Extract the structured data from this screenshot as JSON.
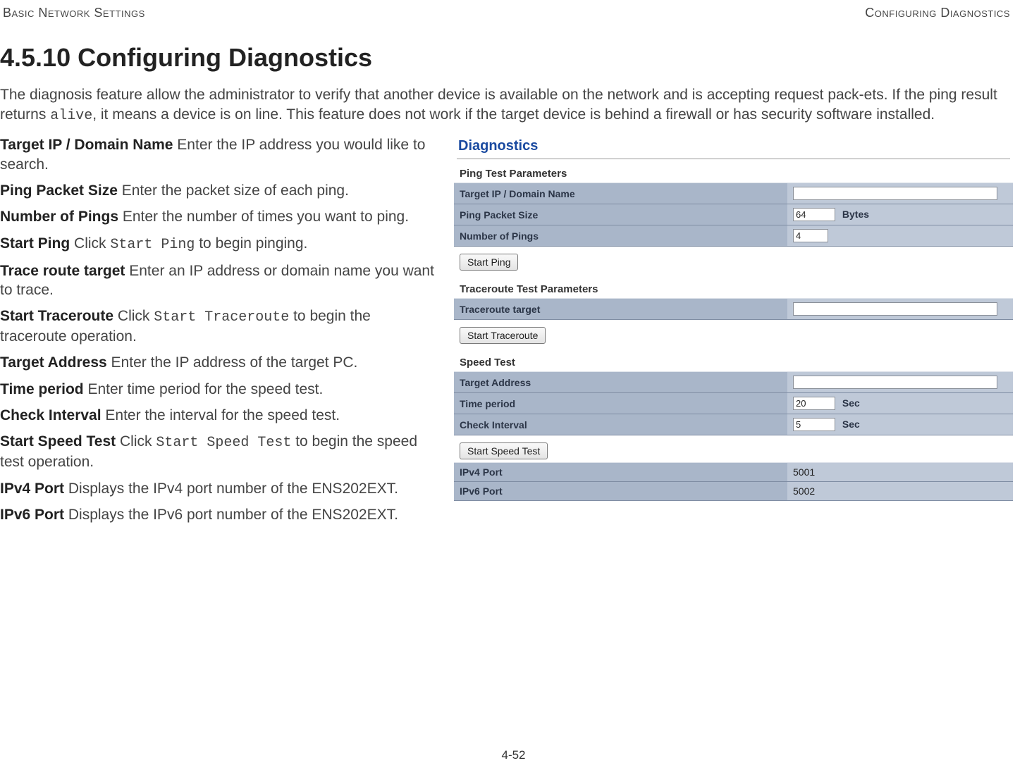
{
  "header": {
    "left": "Basic Network Settings",
    "right": "Configuring Diagnostics"
  },
  "title": "4.5.10 Configuring Diagnostics",
  "intro_parts": {
    "p1": "The diagnosis feature allow the administrator to verify that another device is available on the network and is accepting request pack-ets. If the ping result returns ",
    "alive": "alive",
    "p2": ", it means a device is on line. This feature does not work if the target device is behind a firewall or has security software installed."
  },
  "defs": [
    {
      "term": "Target IP / Domain Name",
      "desc": "   Enter the IP address you would like to search."
    },
    {
      "term": "Ping Packet Size",
      "desc": "  Enter the packet size of each ping."
    },
    {
      "term": "Number of Pings",
      "desc": "  Enter the number of times you want to ping."
    },
    {
      "term": "Start Ping",
      "desc": "  Click ",
      "code": "Start Ping",
      "desc2": " to begin pinging."
    },
    {
      "term": "Trace route target",
      "desc": "  Enter an IP address or domain name you want to trace."
    },
    {
      "term": "Start Traceroute",
      "desc": "  Click ",
      "code": "Start Traceroute",
      "desc2": " to begin the traceroute operation."
    },
    {
      "term": "Target Address",
      "desc": "  Enter the IP address of the target PC."
    },
    {
      "term": "Time period",
      "desc": "  Enter time period for the speed test."
    },
    {
      "term": "Check Interval",
      "desc": "  Enter the interval for the speed test."
    },
    {
      "term": "Start Speed Test",
      "desc": "  Click ",
      "code": "Start Speed Test",
      "desc2": " to begin the speed test operation."
    },
    {
      "term": "IPv4 Port",
      "desc": "  Displays the IPv4 port number of the ENS202EXT."
    },
    {
      "term": "IPv6 Port",
      "desc": "  Displays the IPv6 port number of the ENS202EXT."
    }
  ],
  "screenshot": {
    "title": "Diagnostics",
    "ping": {
      "group": "Ping Test Parameters",
      "rows": {
        "target": {
          "label": "Target IP / Domain Name",
          "value": ""
        },
        "size": {
          "label": "Ping Packet Size",
          "value": "64",
          "unit": "Bytes"
        },
        "count": {
          "label": "Number of Pings",
          "value": "4"
        }
      },
      "button": "Start Ping"
    },
    "trace": {
      "group": "Traceroute Test Parameters",
      "rows": {
        "target": {
          "label": "Traceroute target",
          "value": ""
        }
      },
      "button": "Start Traceroute"
    },
    "speed": {
      "group": "Speed Test",
      "rows": {
        "target": {
          "label": "Target Address",
          "value": ""
        },
        "period": {
          "label": "Time period",
          "value": "20",
          "unit": "Sec"
        },
        "interval": {
          "label": "Check Interval",
          "value": "5",
          "unit": "Sec"
        }
      },
      "button": "Start Speed Test",
      "ports": {
        "ipv4": {
          "label": "IPv4 Port",
          "value": "5001"
        },
        "ipv6": {
          "label": "IPv6 Port",
          "value": "5002"
        }
      }
    }
  },
  "page_number": "4-52"
}
